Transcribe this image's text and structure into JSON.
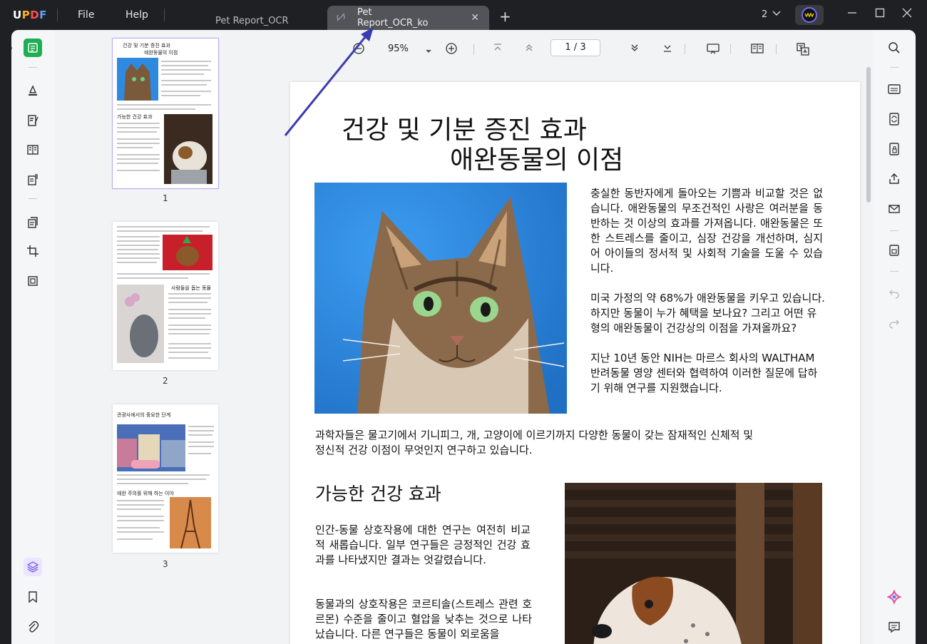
{
  "titlebar": {
    "logo": "UPDF",
    "menu_file": "File",
    "menu_help": "Help",
    "tab1": "Pet Report_OCR",
    "tab2": "Pet Report_OCR_ko",
    "window_count": "2",
    "colors": {
      "accent": "#1fae54",
      "arrow": "#3b3bb0",
      "selection": "#b7a8f5"
    }
  },
  "toolbar": {
    "zoom": "95%",
    "page_indicator": "1  /  3"
  },
  "thumbnails": [
    {
      "number": "1",
      "title1": "건강 및 기분 증진 효과",
      "title2": "애완동물의 이점",
      "heading": "가능한 건강 효과"
    },
    {
      "number": "2",
      "heading": "사람들을 돕는 동물"
    },
    {
      "number": "3",
      "heading": "관광사에서의 중요한 단계",
      "heading2": "애완 주의를 위해 하는 이야"
    }
  ],
  "document": {
    "title_line1": "건강 및 기분 증진 효과",
    "title_line2": "애완동물의 이점",
    "para1": "충실한 동반자에게 돌아오는 기쁨과 비교할 것은 없습니다.   애완동물의   무조건적인   사랑은 여러분을 동반하는 것 이상의 효과를 가져옵니다. 애완동물은 또한 스트레스를 줄이고, 심장 건강을 개선하며, 심지어 아이들의 정서적 및 사회적 기술을 도울 수 있습니다.",
    "para2": "미국 가정의 약 68%가 애완동물을 키우고 있습니다. 하지만 동물이 누가 혜택을 보나요? 그리고 어떤 유형의 애완동물이 건강상의 이점을 가져올까요?",
    "para3": "지난 10년 동안 NIH는 마르스 회사의 WALTHAM 반려동물 영양 센터와 협력하여 이러한 질문에 답하기 위해 연구를 지원했습니다.",
    "para4": "과학자들은 물고기에서 기니피그, 개, 고양이에 이르기까지 다양한 동물이 갖는 잠재적인 신체적 및 정신적 건강 이점이 무엇인지 연구하고 있습니다.",
    "heading2": "가능한 건강 효과",
    "para5": "인간-동물 상호작용에 대한 연구는 여전히 비교적 새롭습니다. 일부 연구들은 긍정적인 건강 효과를 나타냈지만 결과는 엇갈렸습니다.",
    "para6": "동물과의 상호작용은 코르티솔(스트레스 관련 호르몬) 수준을 줄이고 혈압을 낮추는 것으로 나타났습니다. 다른 연구들은 동물이 외로움을"
  }
}
